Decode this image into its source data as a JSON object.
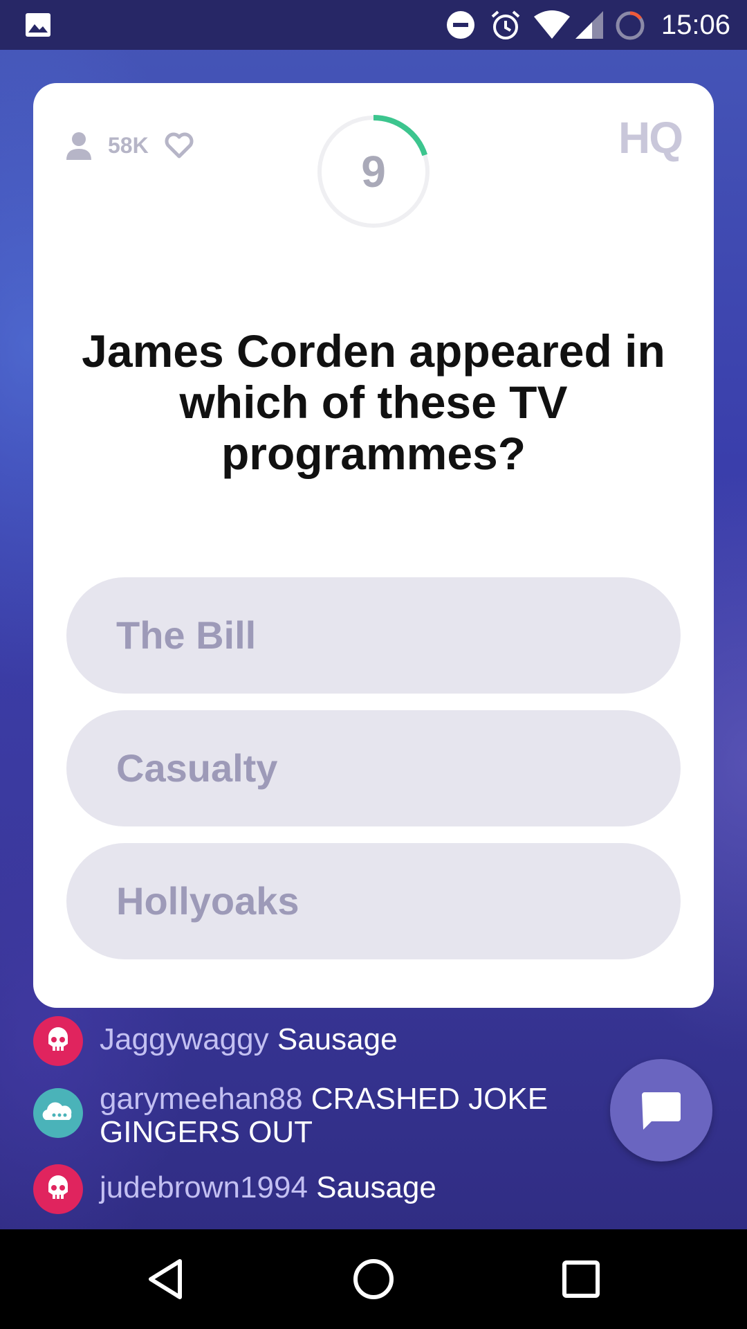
{
  "status_bar": {
    "time": "15:06",
    "icons": [
      "image-icon",
      "do-not-disturb-icon",
      "alarm-icon",
      "wifi-icon",
      "signal-icon",
      "battery-icon"
    ]
  },
  "card": {
    "viewer_count": "58K",
    "timer": "9",
    "timer_progress": 0.2,
    "logo": "HQ",
    "question": "James Corden appeared in which of these TV programmes?",
    "answers": [
      "The Bill",
      "Casualty",
      "Hollyoaks"
    ]
  },
  "chat": [
    {
      "username": "Jaggywaggy",
      "message": "Sausage",
      "avatar_color": "#e0245e",
      "avatar_icon": "skull-icon"
    },
    {
      "username": "garymeehan88",
      "message": "CRASHED JOKE GINGERS OUT",
      "avatar_color": "#4ab3b9",
      "avatar_icon": "cloud-icon"
    },
    {
      "username": "judebrown1994",
      "message": "Sausage",
      "avatar_color": "#e0245e",
      "avatar_icon": "skull-icon"
    }
  ],
  "colors": {
    "accent_green": "#3cc58e",
    "background": "#3b3aa0",
    "chat_button": "#6a65c0"
  },
  "nav": [
    "back-icon",
    "home-icon",
    "recents-icon"
  ]
}
